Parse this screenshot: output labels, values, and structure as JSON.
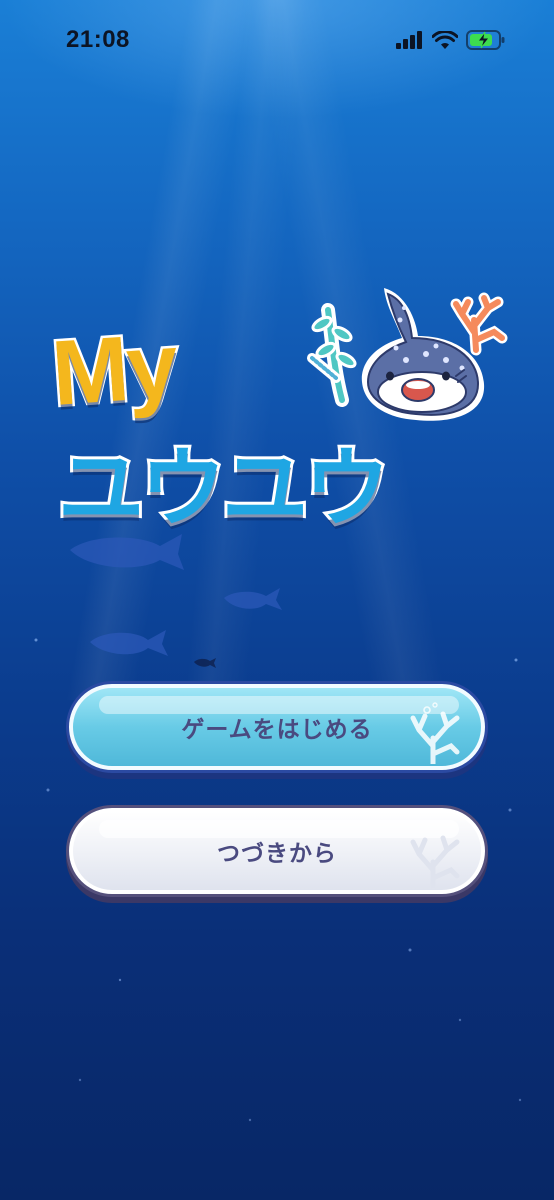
{
  "status_bar": {
    "time": "21:08",
    "icons": [
      "signal-icon",
      "wifi-icon",
      "battery-charging-icon"
    ]
  },
  "logo": {
    "line1": "My",
    "line2": "ユウユウ",
    "colors": {
      "my": "#f4b71d",
      "yuuyuu": "#1fa6e3"
    }
  },
  "buttons": {
    "start_label": "ゲームをはじめる",
    "continue_label": "つづきから"
  },
  "colors": {
    "background_top": "#1a7fd6",
    "background_bottom": "#082766",
    "start_button": "#68cbe6",
    "continue_button": "#eef0f6",
    "button_text": "#4a4a80"
  }
}
